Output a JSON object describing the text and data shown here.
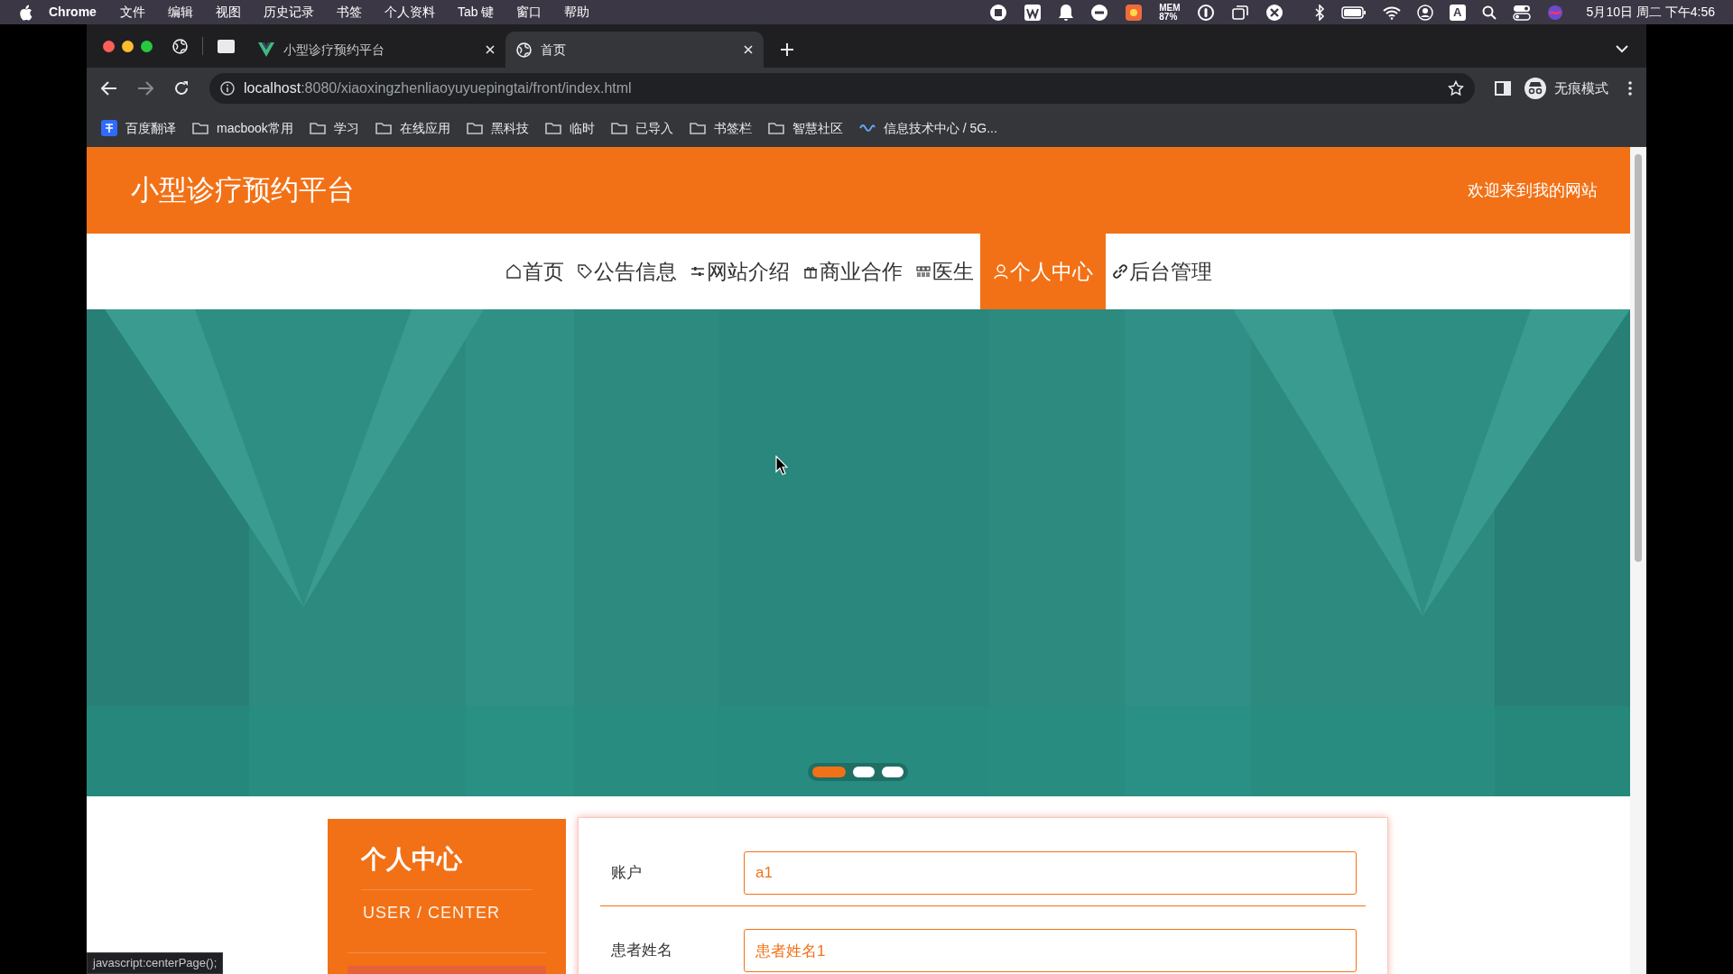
{
  "menu_bar": {
    "app": "Chrome",
    "items": [
      "文件",
      "编辑",
      "视图",
      "历史记录",
      "书签",
      "个人资料",
      "Tab 键",
      "窗口",
      "帮助"
    ],
    "mem_label": "MEM",
    "mem_value": "87%",
    "input_source": "A",
    "clock": "5月10日 周二 下午4:56"
  },
  "browser": {
    "tabs": [
      {
        "title": "小型诊疗预约平台",
        "selected": false,
        "kind": "vue"
      },
      {
        "title": "首页",
        "selected": true,
        "kind": "globe"
      }
    ],
    "url_host": "localhost",
    "url_path": ":8080/xiaoxingzhenliaoyuyuepingtai/front/index.html",
    "profile": "无痕模式",
    "bookmarks": [
      {
        "label": "百度翻译",
        "kind": "translate"
      },
      {
        "label": "macbook常用",
        "kind": "folder"
      },
      {
        "label": "学习",
        "kind": "folder"
      },
      {
        "label": "在线应用",
        "kind": "folder"
      },
      {
        "label": "黑科技",
        "kind": "folder"
      },
      {
        "label": "临时",
        "kind": "folder"
      },
      {
        "label": "已导入",
        "kind": "folder"
      },
      {
        "label": "书签栏",
        "kind": "folder"
      },
      {
        "label": "智慧社区",
        "kind": "folder"
      },
      {
        "label": "信息技术中心 / 5G...",
        "kind": "link"
      }
    ]
  },
  "site": {
    "title": "小型诊疗预约平台",
    "welcome": "欢迎来到我的网站",
    "nav": [
      {
        "label": "首页",
        "selected": false
      },
      {
        "label": "公告信息",
        "selected": false
      },
      {
        "label": "网站介绍",
        "selected": false
      },
      {
        "label": "商业合作",
        "selected": false
      },
      {
        "label": "医生",
        "selected": false
      },
      {
        "label": "个人中心",
        "selected": true
      },
      {
        "label": "后台管理",
        "selected": false
      }
    ]
  },
  "banner": {
    "kind": "picture",
    "dots": [
      {
        "selected": true
      },
      {
        "selected": false
      },
      {
        "selected": false
      }
    ]
  },
  "sidebar": {
    "title": "个人中心",
    "subtitle": "USER / CENTER"
  },
  "form": {
    "fields": [
      {
        "label": "账户",
        "value": "a1"
      },
      {
        "label": "患者姓名",
        "value": "患者姓名1"
      }
    ]
  },
  "status_link": "javascript:centerPage();"
}
